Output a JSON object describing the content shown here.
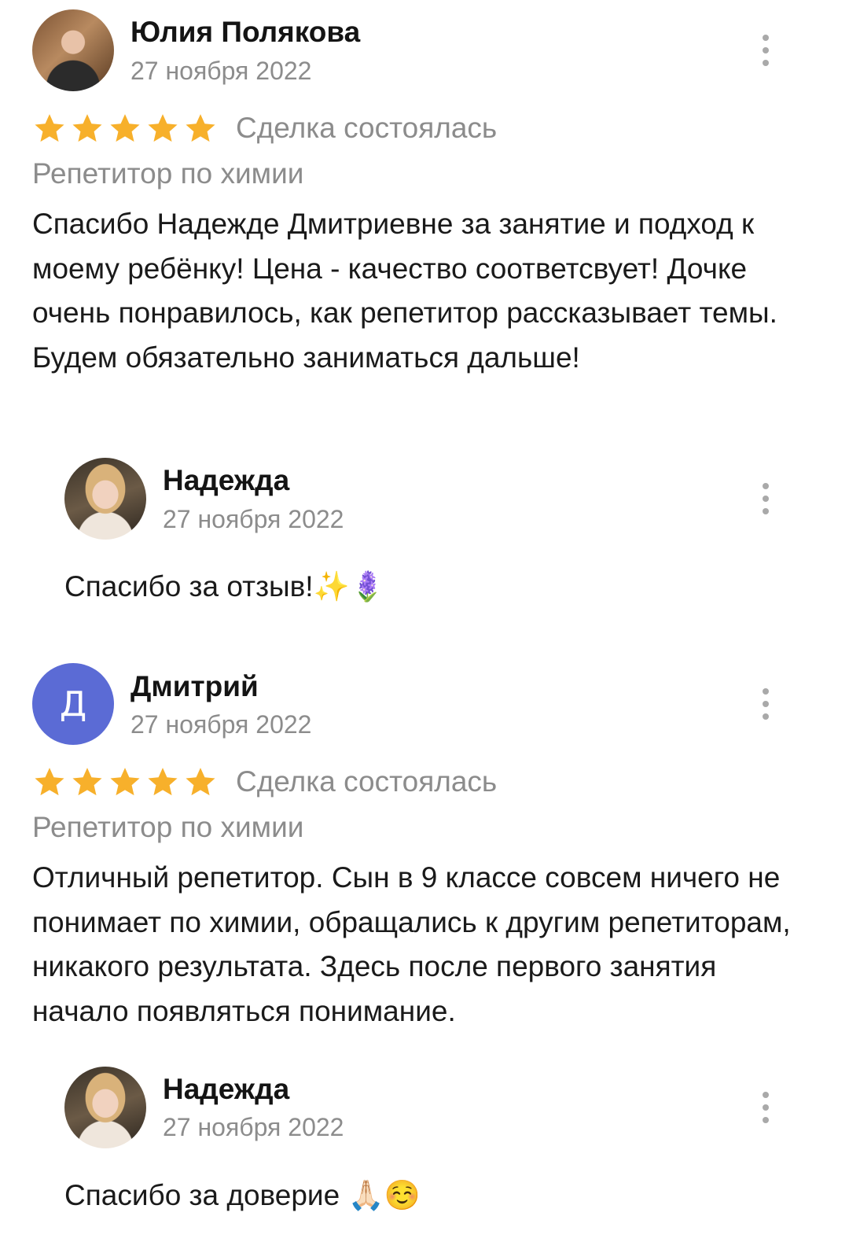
{
  "reviews": [
    {
      "author": "Юлия Полякова",
      "date": "27 ноября 2022",
      "avatar": "photo",
      "rating": 5,
      "deal_status": "Сделка состоялась",
      "subject": "Репетитор по химии",
      "text": "Спасибо Надежде Дмитриевне за занятие и подход к моему ребёнку! Цена - качество соответсвует! Дочке очень понравилось, как репетитор рассказывает темы. Будем обязательно заниматься дальше!",
      "reply": {
        "author": "Надежда",
        "date": "27 ноября 2022",
        "text": "Спасибо за отзыв!✨🪻"
      }
    },
    {
      "author": "Дмитрий",
      "avatar_letter": "Д",
      "date": "27 ноября 2022",
      "rating": 5,
      "deal_status": "Сделка состоялась",
      "subject": "Репетитор по химии",
      "text": "Отличный репетитор. Сын в 9 классе совсем ничего не понимает по химии, обращались к другим репетиторам, никакого результата. Здесь после первого занятия начало появляться понимание.",
      "reply": {
        "author": "Надежда",
        "date": "27 ноября 2022",
        "text": "Спасибо за доверие 🙏🏻☺️"
      }
    }
  ],
  "icons": {
    "star": "star-icon",
    "menu": "more-vertical-icon"
  },
  "colors": {
    "star": "#F7B02B",
    "letter_avatar": "#5B6BD5",
    "secondary_text": "#8C8C8C"
  }
}
